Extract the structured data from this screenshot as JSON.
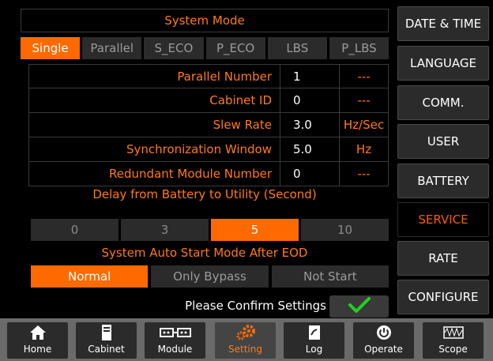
{
  "system_mode": {
    "title": "System Mode",
    "tabs": [
      "Single",
      "Parallel",
      "S_ECO",
      "P_ECO",
      "LBS",
      "P_LBS"
    ],
    "selected": "Single"
  },
  "params": [
    {
      "label": "Parallel Number",
      "value": "1",
      "unit": "---"
    },
    {
      "label": "Cabinet ID",
      "value": "0",
      "unit": "---"
    },
    {
      "label": "Slew Rate",
      "value": "3.0",
      "unit": "Hz/Sec"
    },
    {
      "label": "Synchronization Window",
      "value": "5.0",
      "unit": "Hz"
    },
    {
      "label": "Redundant Module Number",
      "value": "0",
      "unit": "---"
    }
  ],
  "delay": {
    "title": "Delay from Battery to Utility (Second)",
    "options": [
      "0",
      "3",
      "5",
      "10"
    ],
    "selected": "5"
  },
  "auto_start": {
    "title": "System Auto Start Mode After EOD",
    "options": [
      "Normal",
      "Only Bypass",
      "Not Start"
    ],
    "selected": "Normal"
  },
  "confirm": {
    "label": "Please Confirm Settings",
    "icon": "check-icon"
  },
  "side_menu": [
    {
      "label": "DATE & TIME",
      "active": false
    },
    {
      "label": "LANGUAGE",
      "active": false
    },
    {
      "label": "COMM.",
      "active": false
    },
    {
      "label": "USER",
      "active": false
    },
    {
      "label": "BATTERY",
      "active": false
    },
    {
      "label": "SERVICE",
      "active": true
    },
    {
      "label": "RATE",
      "active": false
    },
    {
      "label": "CONFIGURE",
      "active": false
    }
  ],
  "bottom_nav": [
    {
      "label": "Home",
      "icon": "home-icon",
      "active": false
    },
    {
      "label": "Cabinet",
      "icon": "cabinet-icon",
      "active": false
    },
    {
      "label": "Module",
      "icon": "module-icon",
      "active": false
    },
    {
      "label": "Setting",
      "icon": "gears-icon",
      "active": true
    },
    {
      "label": "Log",
      "icon": "log-icon",
      "active": false
    },
    {
      "label": "Operate",
      "icon": "power-icon",
      "active": false
    },
    {
      "label": "Scope",
      "icon": "scope-icon",
      "active": false
    }
  ],
  "colors": {
    "accent": "#ff6a00",
    "text_accent": "#ff7a1a",
    "check": "#22d022"
  }
}
